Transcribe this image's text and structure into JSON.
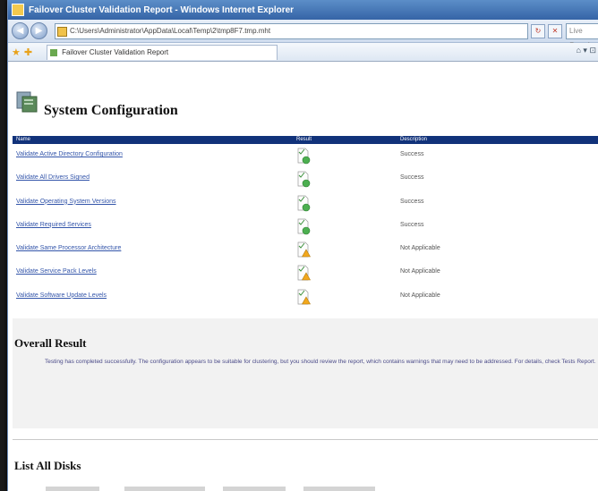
{
  "window": {
    "title": "Failover Cluster Validation Report - Windows Internet Explorer"
  },
  "address_bar": {
    "url": "C:\\Users\\Administrator\\AppData\\Local\\Temp\\2\\tmp8F7.tmp.mht",
    "search_placeholder": "Live Search"
  },
  "favorites_bar": {
    "tab_title": "Failover Cluster Validation Report",
    "tools_text": "⌂ ▾ ⊡ ▾"
  },
  "nav": {
    "back_glyph": "◀",
    "forward_glyph": "▶",
    "refresh_glyph": "↻",
    "stop_glyph": "✕"
  },
  "report": {
    "heading": "System Configuration",
    "columns": [
      "Name",
      "Result",
      "Description"
    ],
    "rows": [
      {
        "name": "Validate Active Directory Configuration",
        "result": "success",
        "description": "Success"
      },
      {
        "name": "Validate All Drivers Signed",
        "result": "success",
        "description": "Success"
      },
      {
        "name": "Validate Operating System Versions",
        "result": "success",
        "description": "Success"
      },
      {
        "name": "Validate Required Services",
        "result": "success",
        "description": "Success"
      },
      {
        "name": "Validate Same Processor Architecture",
        "result": "warning",
        "description": "Not Applicable"
      },
      {
        "name": "Validate Service Pack Levels",
        "result": "warning",
        "description": "Not Applicable"
      },
      {
        "name": "Validate Software Update Levels",
        "result": "warning",
        "description": "Not Applicable"
      }
    ]
  },
  "overall": {
    "heading": "Overall Result",
    "message": "Testing has completed successfully. The configuration appears to be suitable for clustering, but you should review the report, which contains warnings that may need to be addressed. For details, check Tests Report."
  },
  "disks": {
    "heading": "List All Disks"
  },
  "colors": {
    "header_bar": "#11327a",
    "link": "#3355aa",
    "success": "#4caf50",
    "warning": "#f2a81d",
    "red_shape": "#d9232e"
  }
}
